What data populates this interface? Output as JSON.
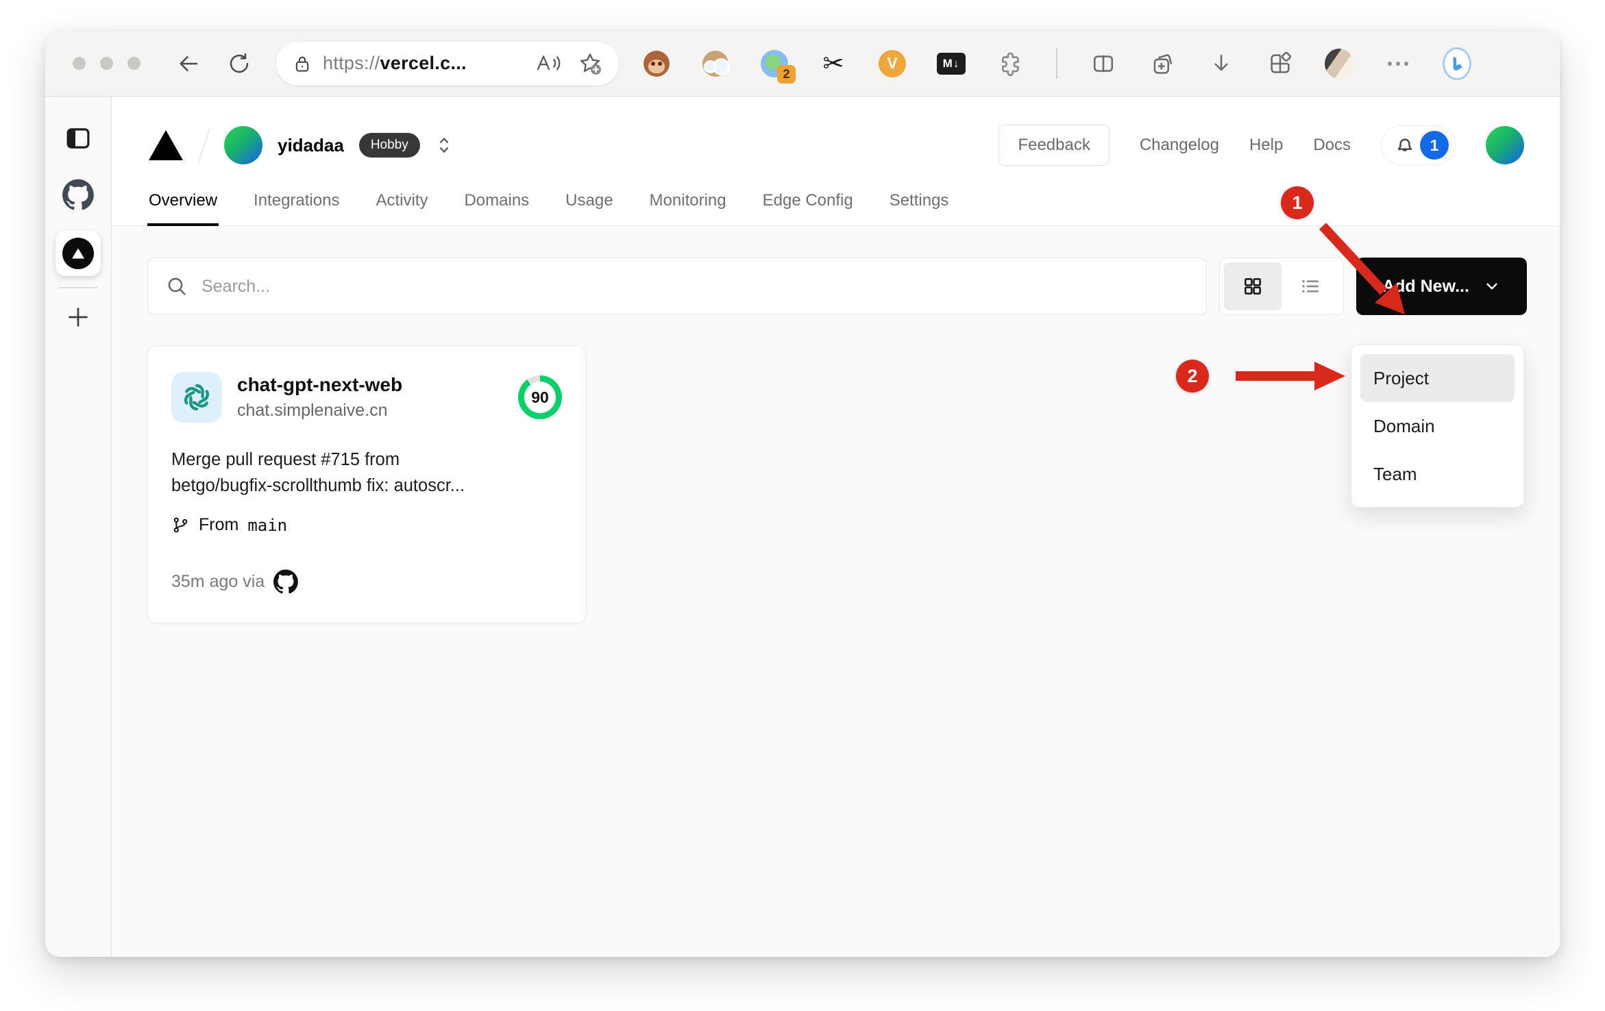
{
  "browser": {
    "url": {
      "prefix": "https://",
      "host": "vercel.c..."
    },
    "extensions": {
      "translate_badge": "2",
      "v_label": "V",
      "markdown_label": "M↓"
    }
  },
  "vercel": {
    "team": {
      "name": "yidadaa",
      "plan": "Hobby"
    },
    "header_links": {
      "feedback": "Feedback",
      "changelog": "Changelog",
      "help": "Help",
      "docs": "Docs"
    },
    "notifications": {
      "count": "1"
    },
    "tabs": [
      {
        "label": "Overview",
        "active": true
      },
      {
        "label": "Integrations",
        "active": false
      },
      {
        "label": "Activity",
        "active": false
      },
      {
        "label": "Domains",
        "active": false
      },
      {
        "label": "Usage",
        "active": false
      },
      {
        "label": "Monitoring",
        "active": false
      },
      {
        "label": "Edge Config",
        "active": false
      },
      {
        "label": "Settings",
        "active": false
      }
    ],
    "search": {
      "placeholder": "Search..."
    },
    "add_new": {
      "label": "Add New..."
    },
    "dropdown": {
      "items": [
        "Project",
        "Domain",
        "Team"
      ]
    },
    "project_card": {
      "name": "chat-gpt-next-web",
      "domain": "chat.simplenaive.cn",
      "score": "90",
      "commit_line1": "Merge pull request #715 from",
      "commit_line2": "betgo/bugfix-scrollthumb fix: autoscr...",
      "branch_label": "From",
      "branch_name": "main",
      "deploy_meta": "35m ago via"
    }
  },
  "annotations": {
    "step1": "1",
    "step2": "2"
  },
  "colors": {
    "accent_red": "#d9291d",
    "badge_blue": "#1569e6",
    "score_green": "#0cce6b",
    "brand_black": "#000000"
  }
}
